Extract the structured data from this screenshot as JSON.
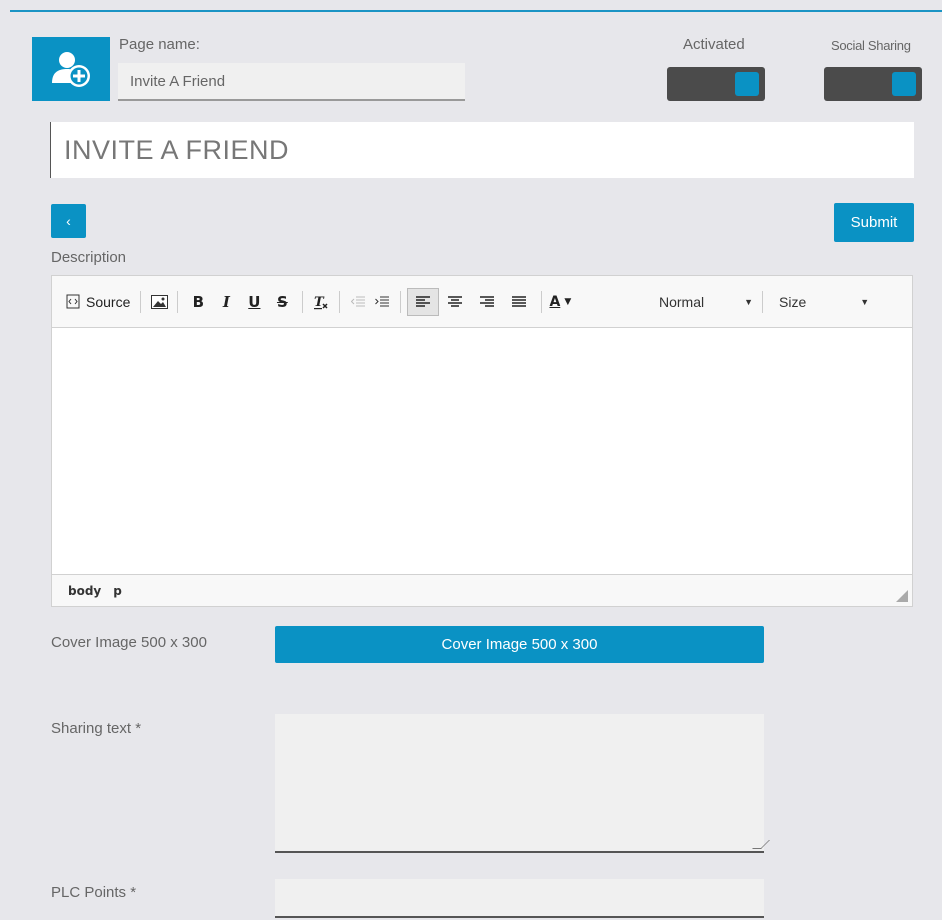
{
  "header": {
    "page_name_label": "Page name:",
    "page_name_value": "Invite A Friend",
    "activated_label": "Activated",
    "social_sharing_label": "Social Sharing",
    "activated_on": true,
    "social_sharing_on": true,
    "page_icon": "add-user-icon"
  },
  "title": {
    "value": "INVITE A FRIEND"
  },
  "nav": {
    "back_label": "‹",
    "submit_label": "Submit"
  },
  "description": {
    "label": "Description",
    "toolbar": {
      "source_label": "Source",
      "bold": "B",
      "italic": "I",
      "underline": "U",
      "strike": "S",
      "font_color": "A",
      "format_value": "Normal",
      "size_value": "Size"
    },
    "path": [
      "body",
      "p"
    ]
  },
  "cover": {
    "label": "Cover Image 500 x 300",
    "button_label": "Cover Image 500 x 300"
  },
  "sharing": {
    "label": "Sharing text *",
    "value": ""
  },
  "plc": {
    "label": "PLC Points *",
    "value": ""
  },
  "colors": {
    "accent": "#0a92c4",
    "toggle_bg": "#4b4b4b",
    "page_bg": "#e7e7eb"
  }
}
